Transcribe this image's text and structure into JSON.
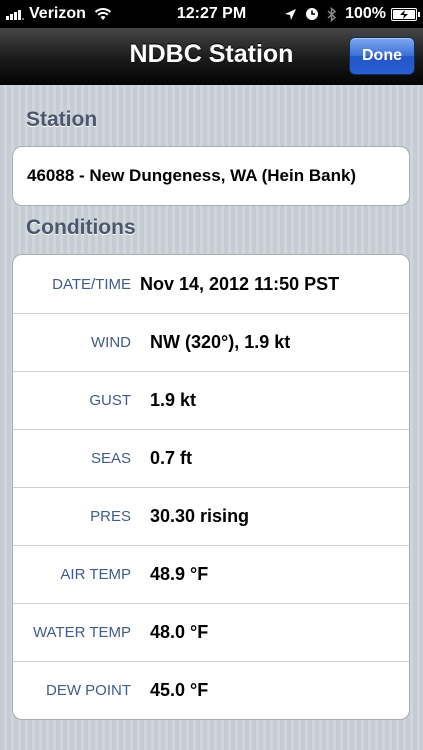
{
  "status_bar": {
    "carrier": "Verizon",
    "time": "12:27 PM",
    "battery_percent": "100%",
    "battery_level": 1.0
  },
  "nav": {
    "title": "NDBC Station",
    "done_label": "Done"
  },
  "station_section": {
    "header": "Station",
    "value": "46088 - New Dungeness, WA (Hein Bank)"
  },
  "conditions_section": {
    "header": "Conditions",
    "rows": [
      {
        "label": "DATE/TIME",
        "value": "Nov 14, 2012 11:50 PST"
      },
      {
        "label": "WIND",
        "value": "NW (320°), 1.9 kt"
      },
      {
        "label": "GUST",
        "value": "1.9 kt"
      },
      {
        "label": "SEAS",
        "value": "0.7 ft"
      },
      {
        "label": "PRES",
        "value": "30.30 rising"
      },
      {
        "label": "AIR TEMP",
        "value": "48.9 °F"
      },
      {
        "label": "WATER TEMP",
        "value": "48.0 °F"
      },
      {
        "label": "DEW POINT",
        "value": "45.0 °F"
      }
    ]
  }
}
